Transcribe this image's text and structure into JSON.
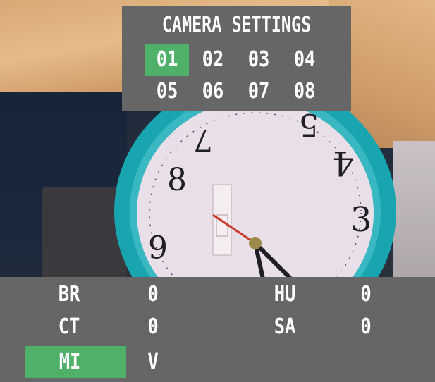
{
  "camera_settings": {
    "title": "CAMERA SETTINGS",
    "cameras": [
      "01",
      "02",
      "03",
      "04",
      "05",
      "06",
      "07",
      "08"
    ],
    "selected_camera": "01"
  },
  "adjustments": {
    "rows": [
      {
        "label": "BR",
        "value": "0"
      },
      {
        "label": "HU",
        "value": "0"
      },
      {
        "label": "CT",
        "value": "0"
      },
      {
        "label": "SA",
        "value": "0"
      },
      {
        "label": "MI",
        "value": "V"
      }
    ],
    "selected_label": "MI"
  },
  "colors": {
    "osd_panel": "#666666",
    "highlight": "#4fb06a",
    "text": "#ffffff"
  }
}
